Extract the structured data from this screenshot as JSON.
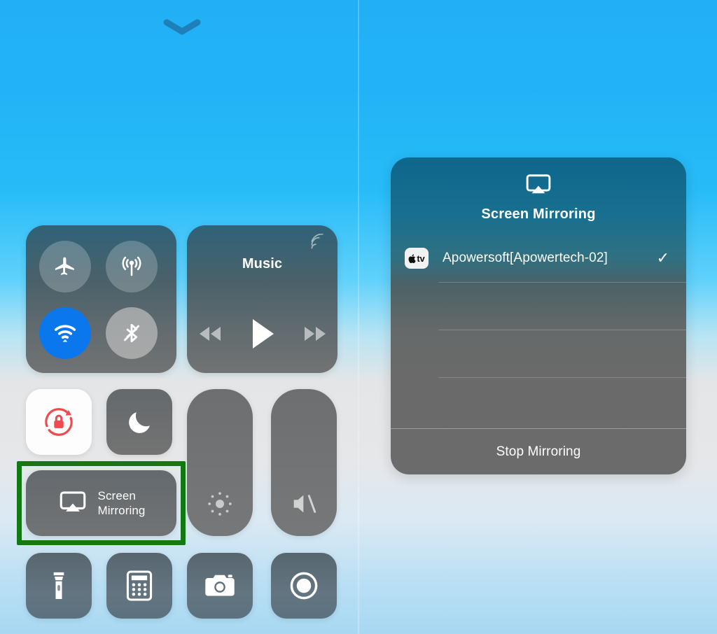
{
  "left_panel": {
    "grabber": "chevron-down",
    "connectivity": {
      "airplane": {
        "label": "Airplane Mode",
        "state": "off"
      },
      "cellular": {
        "label": "Cellular Data",
        "state": "off"
      },
      "wifi": {
        "label": "Wi-Fi",
        "state": "on",
        "color": "#0b77ed"
      },
      "bluetooth": {
        "label": "Bluetooth",
        "state": "off"
      }
    },
    "music": {
      "title": "Music",
      "rewind": "Rewind",
      "play": "Play",
      "forward": "Fast Forward",
      "route": "AirPlay"
    },
    "rotation_lock": {
      "label": "Portrait Orientation Lock",
      "state": "on",
      "color": "#f04a51"
    },
    "do_not_disturb": {
      "label": "Do Not Disturb",
      "state": "off"
    },
    "screen_mirroring": {
      "label_line1": "Screen",
      "label_line2": "Mirroring",
      "state": "off"
    },
    "brightness": {
      "label": "Brightness",
      "level": 4
    },
    "volume": {
      "label": "Volume",
      "level": 4,
      "state": "muted"
    },
    "utilities": [
      {
        "name": "Flashlight"
      },
      {
        "name": "Calculator"
      },
      {
        "name": "Camera"
      },
      {
        "name": "Screen Recording"
      }
    ],
    "highlight": {
      "target": "Screen Mirroring",
      "color": "#117a13"
    }
  },
  "right_panel": {
    "dialog": {
      "title": "Screen Mirroring",
      "icon": "airplay-video",
      "devices": [
        {
          "name": "Apowersoft[Apowertech-02]",
          "icon": "apple-tv",
          "icon_text": "tv",
          "selected": true,
          "check": "✓"
        },
        {
          "name": "",
          "selected": false
        },
        {
          "name": "",
          "selected": false
        },
        {
          "name": "",
          "selected": false
        }
      ],
      "stop_label": "Stop Mirroring"
    }
  }
}
